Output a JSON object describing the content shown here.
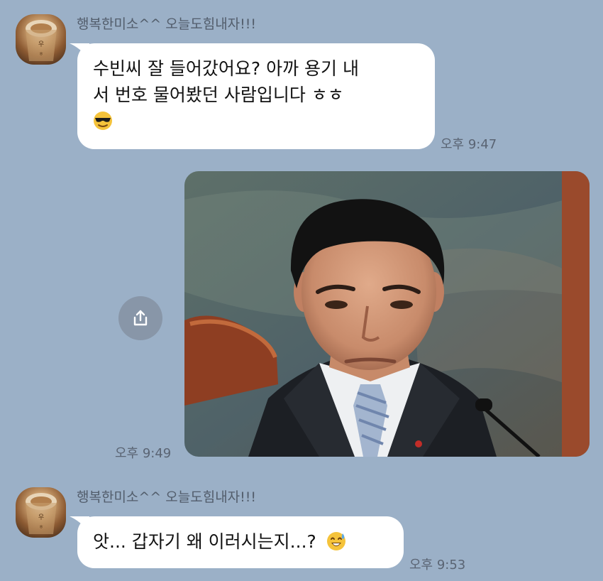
{
  "messages": [
    {
      "sender": "행복한미소^^ 오늘도힘내자!!!",
      "line1": "수빈씨 잘 들어갔어요? 아까 용기 내",
      "line2": "서 번호 물어봤던 사람입니다 ㅎㅎ",
      "emoji": "smiling-face-with-sunglasses",
      "time": "오후 9:47"
    },
    {
      "type": "photo",
      "content": "photo of a man in a dark suit and striped tie",
      "time": "오후 9:49",
      "share_icon": "share-icon"
    },
    {
      "sender": "행복한미소^^ 오늘도힘내자!!!",
      "text": "앗... 갑자기 왜 이러시는지...?",
      "emoji": "grinning-face-with-sweat",
      "time": "오후 9:53"
    }
  ],
  "colors": {
    "background": "#9bb0c7",
    "bubble": "#ffffff",
    "share_button": "#8896a8"
  }
}
